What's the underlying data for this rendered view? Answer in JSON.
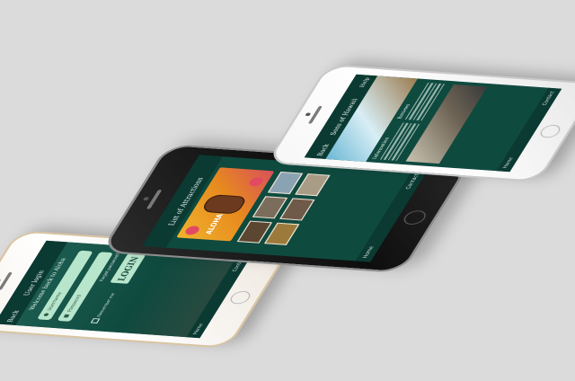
{
  "phones": {
    "login": {
      "header_title": "User login",
      "back_label": "Back",
      "prompt": "Welcome back to Aloha",
      "username_placeholder": "Username",
      "password_placeholder": "Password",
      "forgot_label": "Forgot password?",
      "remember_label": "Remember me",
      "login_button": "LOGIN",
      "tab_left": "Home",
      "tab_right": "Contact"
    },
    "gallery": {
      "header_title": "List of Attractions",
      "poster_text": "ALOHA",
      "tab_left": "Home",
      "tab_right": "Contact"
    },
    "info": {
      "back_label": "Back",
      "right_label": "Help",
      "header_title": "Sons of Hawaii",
      "col1_heading": "Information",
      "col2_heading": "Reviews",
      "tab_left": "Home",
      "tab_right": "Contact"
    }
  },
  "colors": {
    "background": "#dcdbdb",
    "screen_green": "#0f4a3f",
    "field_mint": "#b8e6cc"
  }
}
